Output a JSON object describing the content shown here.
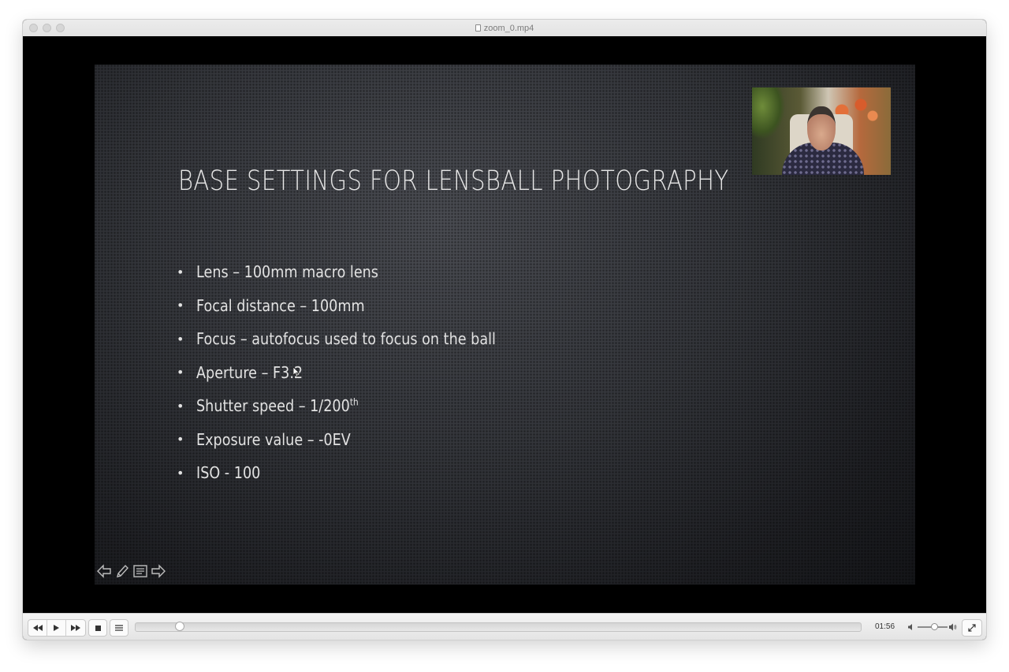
{
  "window": {
    "title": "zoom_0.mp4"
  },
  "slide": {
    "title": "BASE SETTINGS FOR LENSBALL PHOTOGRAPHY",
    "bullets": [
      {
        "text": "Lens – 100mm macro lens"
      },
      {
        "text": "Focal distance – 100mm"
      },
      {
        "text": "Focus – autofocus used to focus on the ball"
      },
      {
        "text": "Aperture – F3.2"
      },
      {
        "text": "Shutter speed – 1/200",
        "sup": "th"
      },
      {
        "text": "Exposure value – -0EV"
      },
      {
        "text": "ISO - 100"
      }
    ]
  },
  "controls": {
    "time": "01:56",
    "progress_fraction": 0.033,
    "volume_fraction": 0.55
  },
  "colors": {
    "slide_text": "#e2e2e2",
    "player_bar": "#e8e8e8"
  }
}
